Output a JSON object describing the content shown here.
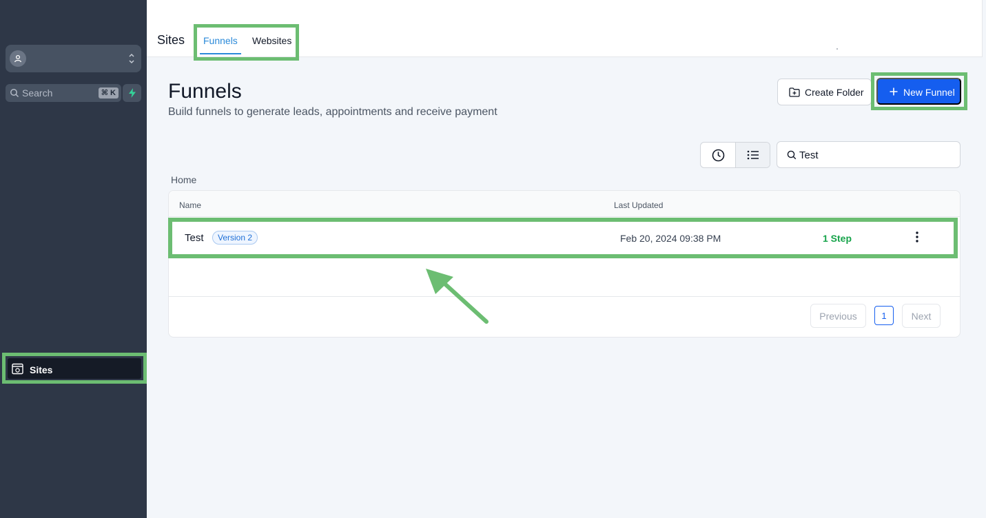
{
  "sidebar": {
    "search_label": "Search",
    "search_shortcut": "⌘ K",
    "nav_sites_label": "Sites"
  },
  "header": {
    "section_title": "Sites",
    "tabs": [
      {
        "label": "Funnels",
        "active": true
      },
      {
        "label": "Websites",
        "active": false
      }
    ]
  },
  "page": {
    "title": "Funnels",
    "subtitle": "Build funnels to generate leads, appointments and receive payment",
    "create_folder_label": "Create Folder",
    "new_funnel_label": "New Funnel",
    "search_value": "Test",
    "breadcrumb": "Home"
  },
  "table": {
    "columns": [
      "Name",
      "Last Updated"
    ],
    "rows": [
      {
        "name": "Test",
        "badge": "Version 2",
        "last_updated": "Feb 20, 2024 09:38 PM",
        "steps": "1 Step"
      }
    ]
  },
  "pagination": {
    "previous_label": "Previous",
    "current_page": "1",
    "next_label": "Next"
  },
  "colors": {
    "sidebar_bg": "#2e3747",
    "primary": "#155eef",
    "tab_active": "#2b8ad9",
    "success": "#16a34a",
    "highlight": "#6cbd72"
  },
  "icons": {
    "account": "user-circle-icon",
    "account_switch": "chevron-up-down-icon",
    "search": "search-icon",
    "quick_action": "bolt-icon",
    "sites_nav": "browser-window-icon",
    "create_folder": "folder-plus-icon",
    "new_funnel": "plus-icon",
    "recent_view": "clock-icon",
    "list_view": "list-icon",
    "row_menu": "kebab-menu-icon"
  }
}
